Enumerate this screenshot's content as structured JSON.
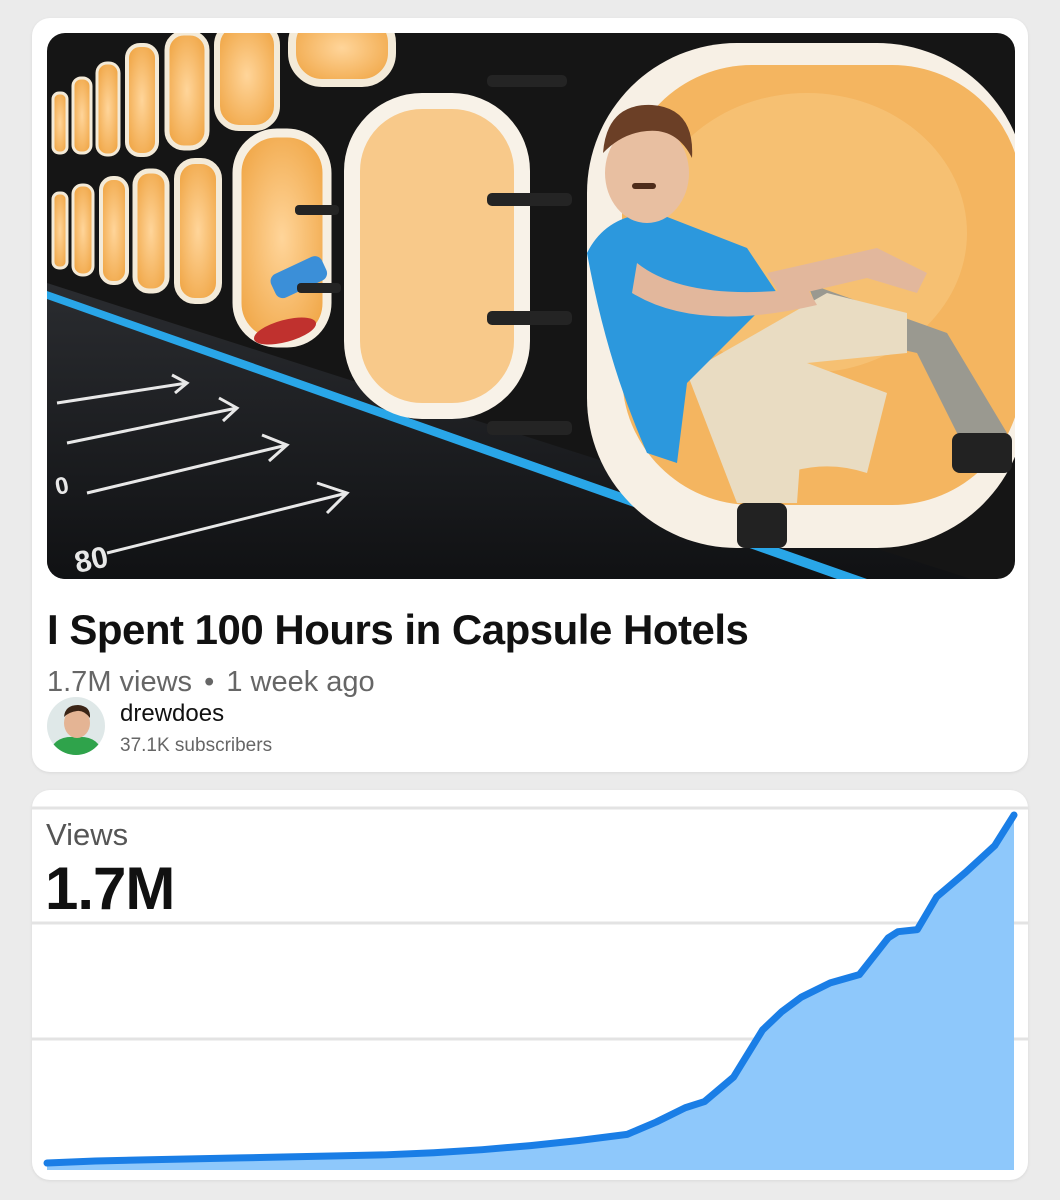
{
  "video": {
    "title": "I Spent 100 Hours in Capsule Hotels",
    "views": "1.7M views",
    "separator": "•",
    "age": "1 week ago",
    "thumbnail_icon": "capsule-hotel-thumbnail",
    "channel": {
      "name": "drewdoes",
      "subscribers": "37.1K subscribers",
      "avatar_icon": "channel-avatar"
    }
  },
  "stats": {
    "metric_label": "Views",
    "metric_value": "1.7M"
  },
  "colors": {
    "line": "#1a7ee6",
    "fill": "#8ec8fb",
    "grid": "#e3e3e3",
    "card": "#ffffff",
    "background": "#ebebeb"
  },
  "chart_data": {
    "type": "area",
    "title": "Views",
    "grid": true,
    "x": [
      0,
      0.05,
      0.1,
      0.15,
      0.2,
      0.25,
      0.3,
      0.35,
      0.4,
      0.45,
      0.5,
      0.55,
      0.6,
      0.63,
      0.66,
      0.68,
      0.71,
      0.74,
      0.76,
      0.78,
      0.81,
      0.84,
      0.86,
      0.87,
      0.88,
      0.9,
      0.92,
      0.95,
      0.98,
      1.0
    ],
    "values": [
      0.0,
      0.01,
      0.015,
      0.02,
      0.025,
      0.03,
      0.035,
      0.04,
      0.05,
      0.065,
      0.085,
      0.11,
      0.14,
      0.2,
      0.27,
      0.3,
      0.42,
      0.65,
      0.74,
      0.81,
      0.88,
      0.92,
      1.04,
      1.1,
      1.13,
      1.14,
      1.3,
      1.42,
      1.55,
      1.7
    ]
  }
}
